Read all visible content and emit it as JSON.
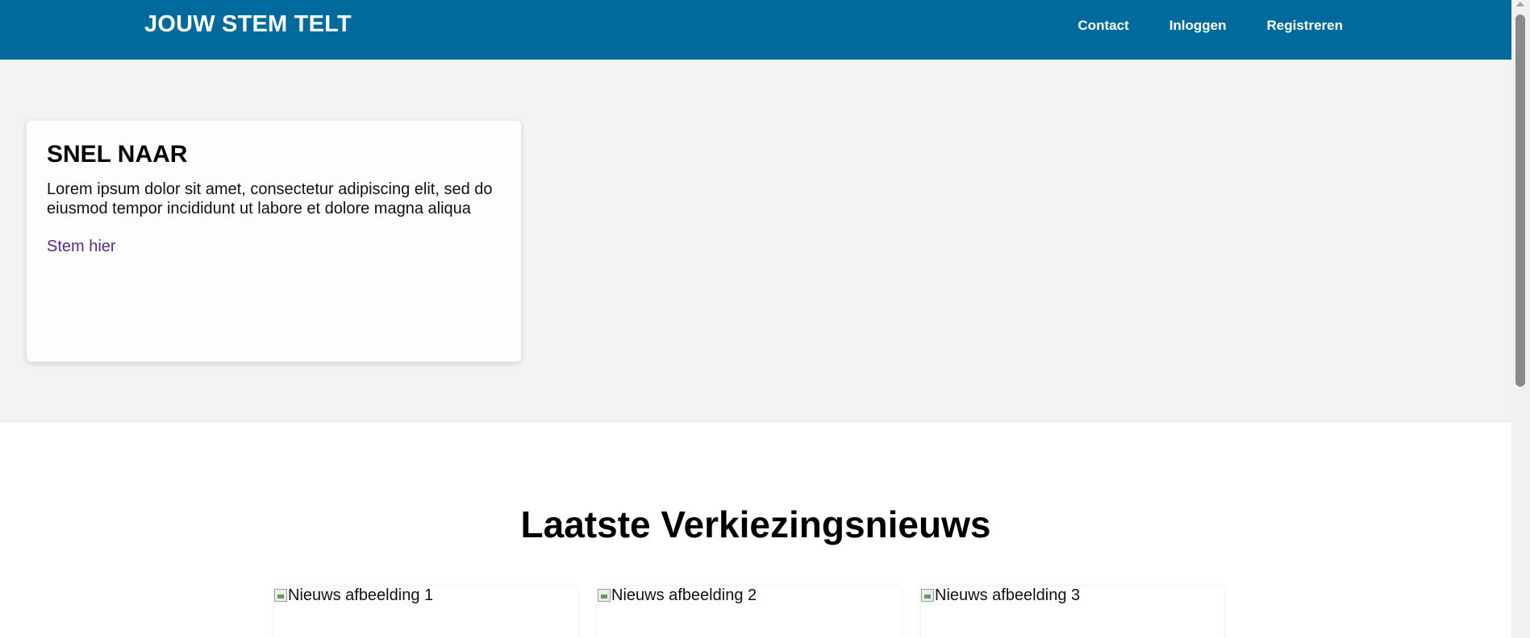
{
  "header": {
    "brand": "JOUW STEM TELT",
    "nav": [
      "Contact",
      "Inloggen",
      "Registreren"
    ]
  },
  "hero": {
    "card": {
      "title": "SNEL NAAR",
      "text": "Lorem ipsum dolor sit amet, consectetur adipiscing elit, sed do eiusmod tempor incididunt ut labore et dolore magna aliqua",
      "link": "Stem hier"
    }
  },
  "news": {
    "title": "Laatste Verkiezingsnieuws",
    "items": [
      {
        "alt": "Nieuws afbeelding 1"
      },
      {
        "alt": "Nieuws afbeelding 2"
      },
      {
        "alt": "Nieuws afbeelding 3"
      }
    ]
  },
  "colors": {
    "header_bg": "#006a9d",
    "hero_bg": "#f3f3f3",
    "link": "#5a2a8a"
  }
}
